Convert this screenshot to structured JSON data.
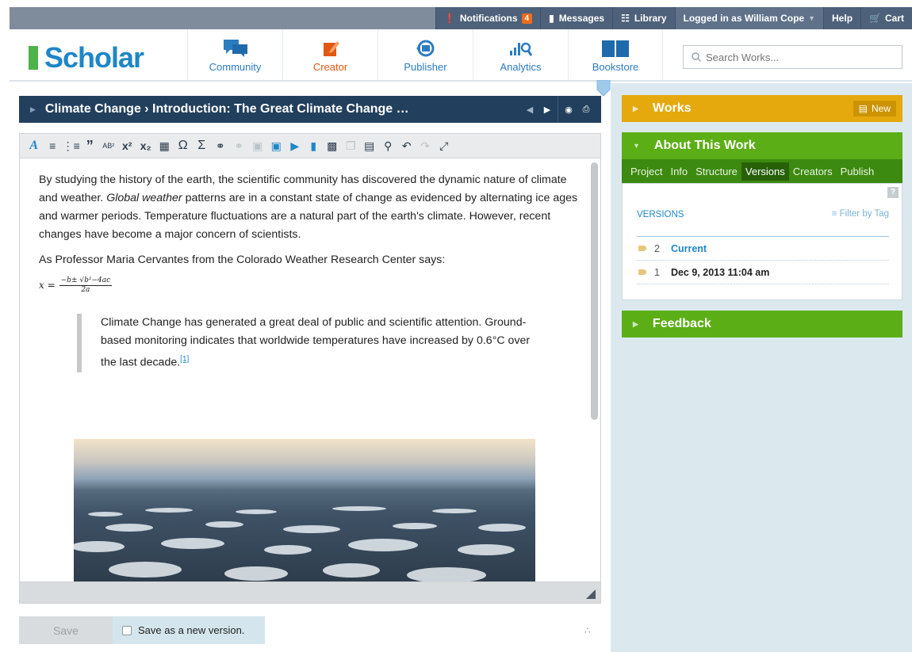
{
  "topbar": {
    "notifications_label": "Notifications",
    "notifications_count": "4",
    "messages_label": "Messages",
    "library_label": "Library",
    "user_label": "Logged in as William Cope",
    "help_label": "Help",
    "cart_label": "Cart"
  },
  "header": {
    "logo": "Scholar",
    "nav": [
      {
        "label": "Community",
        "icon": "community-icon"
      },
      {
        "label": "Creator",
        "icon": "creator-icon"
      },
      {
        "label": "Publisher",
        "icon": "publisher-icon"
      },
      {
        "label": "Analytics",
        "icon": "analytics-icon"
      },
      {
        "label": "Bookstore",
        "icon": "bookstore-icon"
      }
    ],
    "search_placeholder": "Search Works..."
  },
  "colors": {
    "brand_blue": "#1f86c7",
    "creator_orange": "#e1580f",
    "works_yellow": "#e5a90d",
    "panel_green": "#5cae16",
    "doc_bar_navy": "#22405e"
  },
  "editor": {
    "title": "Climate Change › Introduction: The Great Climate Change …",
    "toolbar_icons": [
      "font-style-icon",
      "ordered-list-icon",
      "bullet-list-icon",
      "blockquote-icon",
      "ab-superscript-icon",
      "superscript-icon",
      "subscript-icon",
      "table-icon",
      "omega-icon",
      "sigma-icon",
      "link-icon",
      "unlink-icon",
      "insert-image-icon",
      "insert-media-icon",
      "play-media-icon",
      "insert-file-icon",
      "insert-widget-icon",
      "copy-icon",
      "paste-icon",
      "find-icon",
      "undo-icon",
      "redo-icon",
      "fullscreen-icon"
    ],
    "paragraph1_a": "By studying the history of the earth, the scientific community has discovered the dynamic nature of climate and weather. ",
    "paragraph1_em": "Global weather",
    "paragraph1_b": " patterns are in a constant state of change as evidenced by alternating ice ages and warmer periods. Temperature fluctuations are a natural part of the earth's climate. However, recent changes have become a major concern of scientists.",
    "paragraph2": "As Professor Maria Cervantes from the Colorado Weather Research Center says:",
    "formula_lhs": "x =",
    "formula_num": "−b± √b²−4ac",
    "formula_den": "2a",
    "quote": "Climate Change has generated a great deal of public and scientific attention. Ground-based monitoring indicates that worldwide temperatures have increased by 0.6°C over the last decade.",
    "quote_ref": "[1]"
  },
  "save": {
    "button_label": "Save",
    "new_version_label": "Save as a new version."
  },
  "sidebar": {
    "works_title": "Works",
    "new_label": "New",
    "about_title": "About This Work",
    "tabs": [
      "Project",
      "Info",
      "Structure",
      "Versions",
      "Creators",
      "Publish"
    ],
    "active_tab": "Versions",
    "versions_title": "VERSIONS",
    "filter_label": "Filter by Tag",
    "versions": [
      {
        "number": "2",
        "label": "Current"
      },
      {
        "number": "1",
        "label": "Dec 9, 2013 11:04 am"
      }
    ],
    "feedback_title": "Feedback"
  }
}
